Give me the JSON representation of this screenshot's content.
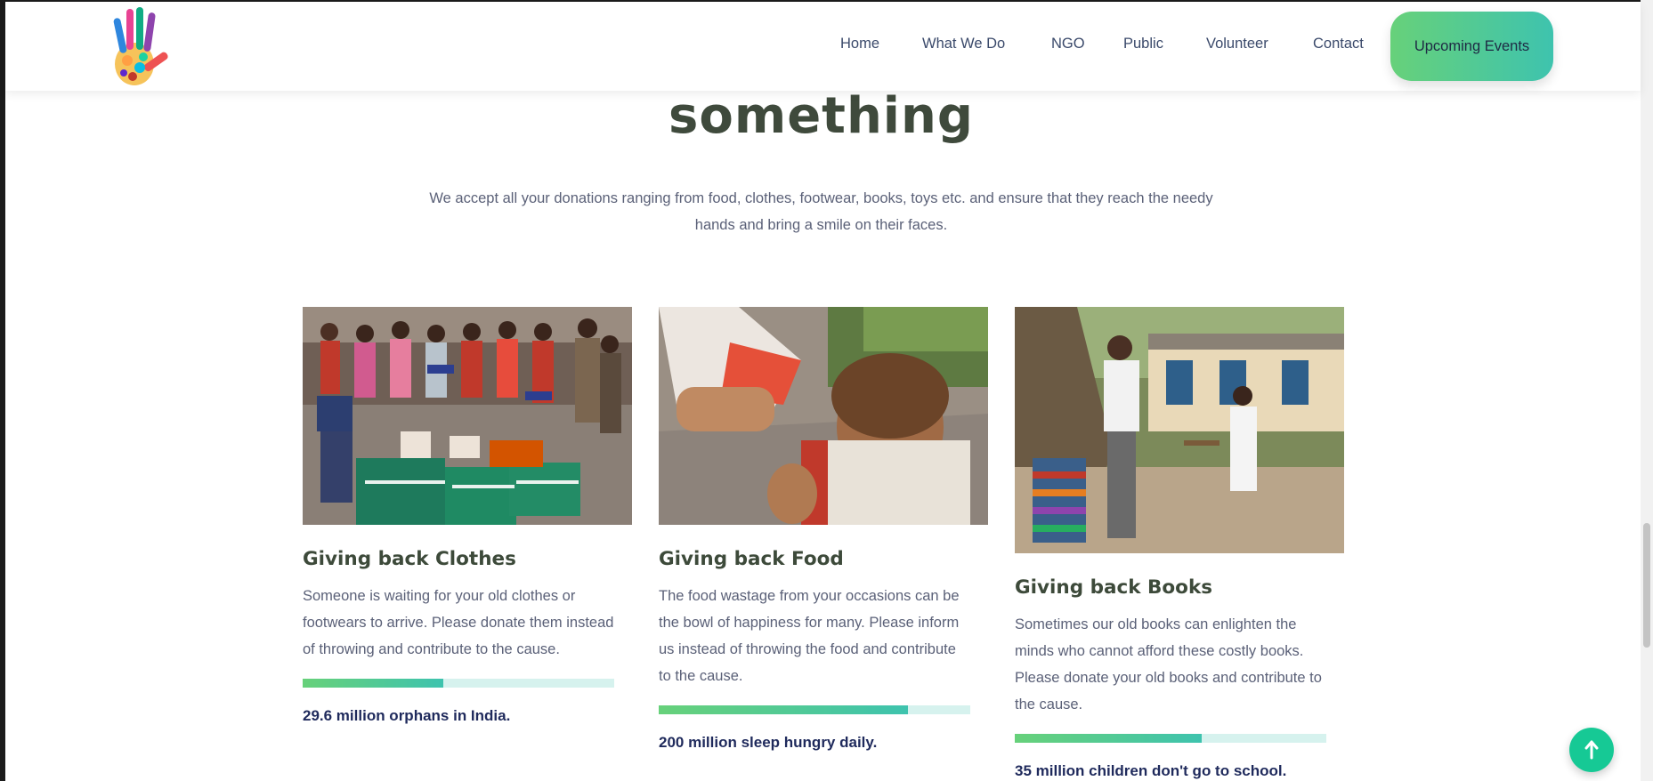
{
  "nav": {
    "items": [
      "Home",
      "What We Do",
      "NGO",
      "Public",
      "Volunteer",
      "Contact"
    ],
    "cta_label": "Upcoming Events"
  },
  "section": {
    "heading": "something",
    "intro": "We accept all your donations ranging from food, clothes, footwear, books, toys etc. and ensure that they reach the needy hands and bring a smile on their faces."
  },
  "cards": [
    {
      "title": "Giving back Clothes",
      "description": "Someone is waiting for your old clothes or footwears to arrive. Please donate them instead of throwing and contribute to the cause.",
      "progress": 0.45,
      "stat": "29.6 million orphans in India."
    },
    {
      "title": "Giving back Food",
      "description": "The food wastage from your occasions can be the bowl of happiness for many. Please inform us instead of throwing the food and contribute to the cause.",
      "progress": 0.8,
      "stat": "200 million sleep hungry daily."
    },
    {
      "title": "Giving back Books",
      "description": "Sometimes our old books can enlighten the minds who cannot afford these costly books. Please donate your old books and contribute to the cause.",
      "progress": 0.6,
      "stat": "35 million children don't go to school."
    }
  ],
  "icons": {
    "logo": "handprint-logo",
    "scroll_top": "arrow-up-icon"
  },
  "colors": {
    "accent_start": "#67d17a",
    "accent_end": "#3ec3ae",
    "stat_text": "#1f2a5c",
    "fab": "#16c995"
  }
}
